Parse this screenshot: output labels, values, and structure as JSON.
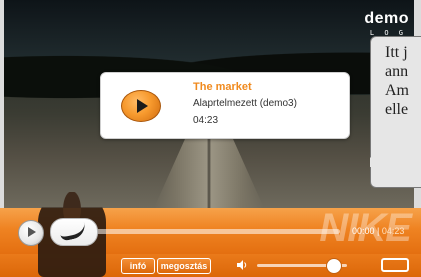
{
  "player": {
    "logo": "demo",
    "logo_sub": "L O G",
    "annotation_lines": [
      "Itt j",
      "ann",
      "Am",
      "elle"
    ],
    "card": {
      "title": "The market",
      "subtitle": "Alaprtelmezett (demo3)",
      "duration": "04:23"
    },
    "controls": {
      "time_current": "00:00",
      "time_separator": "|",
      "time_total": "04:23",
      "info_label": "infó",
      "share_label": "megosztás",
      "brand_watermark": "NIKE",
      "progress_fraction": 0.0,
      "volume_fraction": 0.8
    }
  },
  "colors": {
    "accent_orange": "#ef8322",
    "title_orange": "#f08a1e"
  }
}
